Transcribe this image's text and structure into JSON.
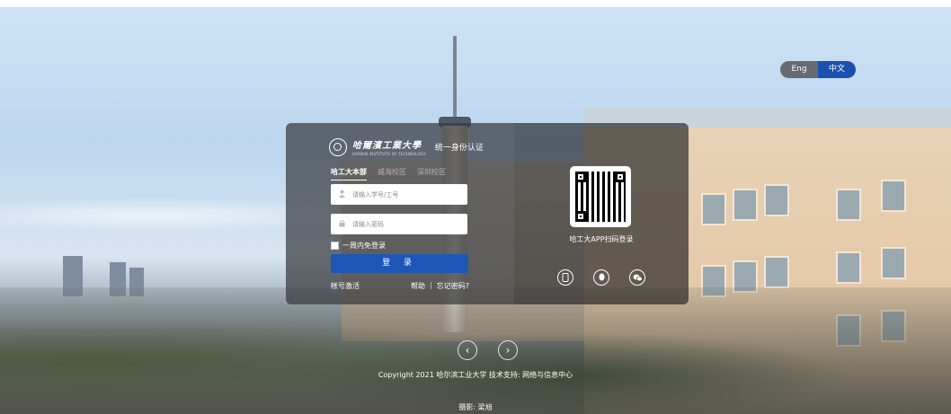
{
  "language_toggle": {
    "english": "Eng",
    "chinese": "中文"
  },
  "login": {
    "school_name": "哈爾濱工業大學",
    "school_name_en": "HARBIN INSTITUTE OF TECHNOLOGY",
    "system_title": "统一身份认证",
    "tabs": [
      "哈工大本部",
      "威海校区",
      "深圳校区"
    ],
    "username_placeholder": "请输入学号/工号",
    "password_placeholder": "请输入密码",
    "remember_label": "一周内免登录",
    "login_button": "登 录",
    "activate_link": "帐号激活",
    "help_link": "帮助",
    "separator": "|",
    "forgot_link": "忘记密码?"
  },
  "qr": {
    "label": "哈工大APP扫码登录"
  },
  "social": [
    "mobile-icon",
    "qq-icon",
    "wechat-icon"
  ],
  "carousel": {
    "prev": "‹",
    "next": "›"
  },
  "footer": {
    "copyright": "Copyright  2021 哈尔滨工业大学 技术支持: 网络与信息中心"
  },
  "photo_credit": "摄影: 梁旭",
  "colors": {
    "primary": "#1e56b7",
    "panel_dark": "#373a3e"
  }
}
